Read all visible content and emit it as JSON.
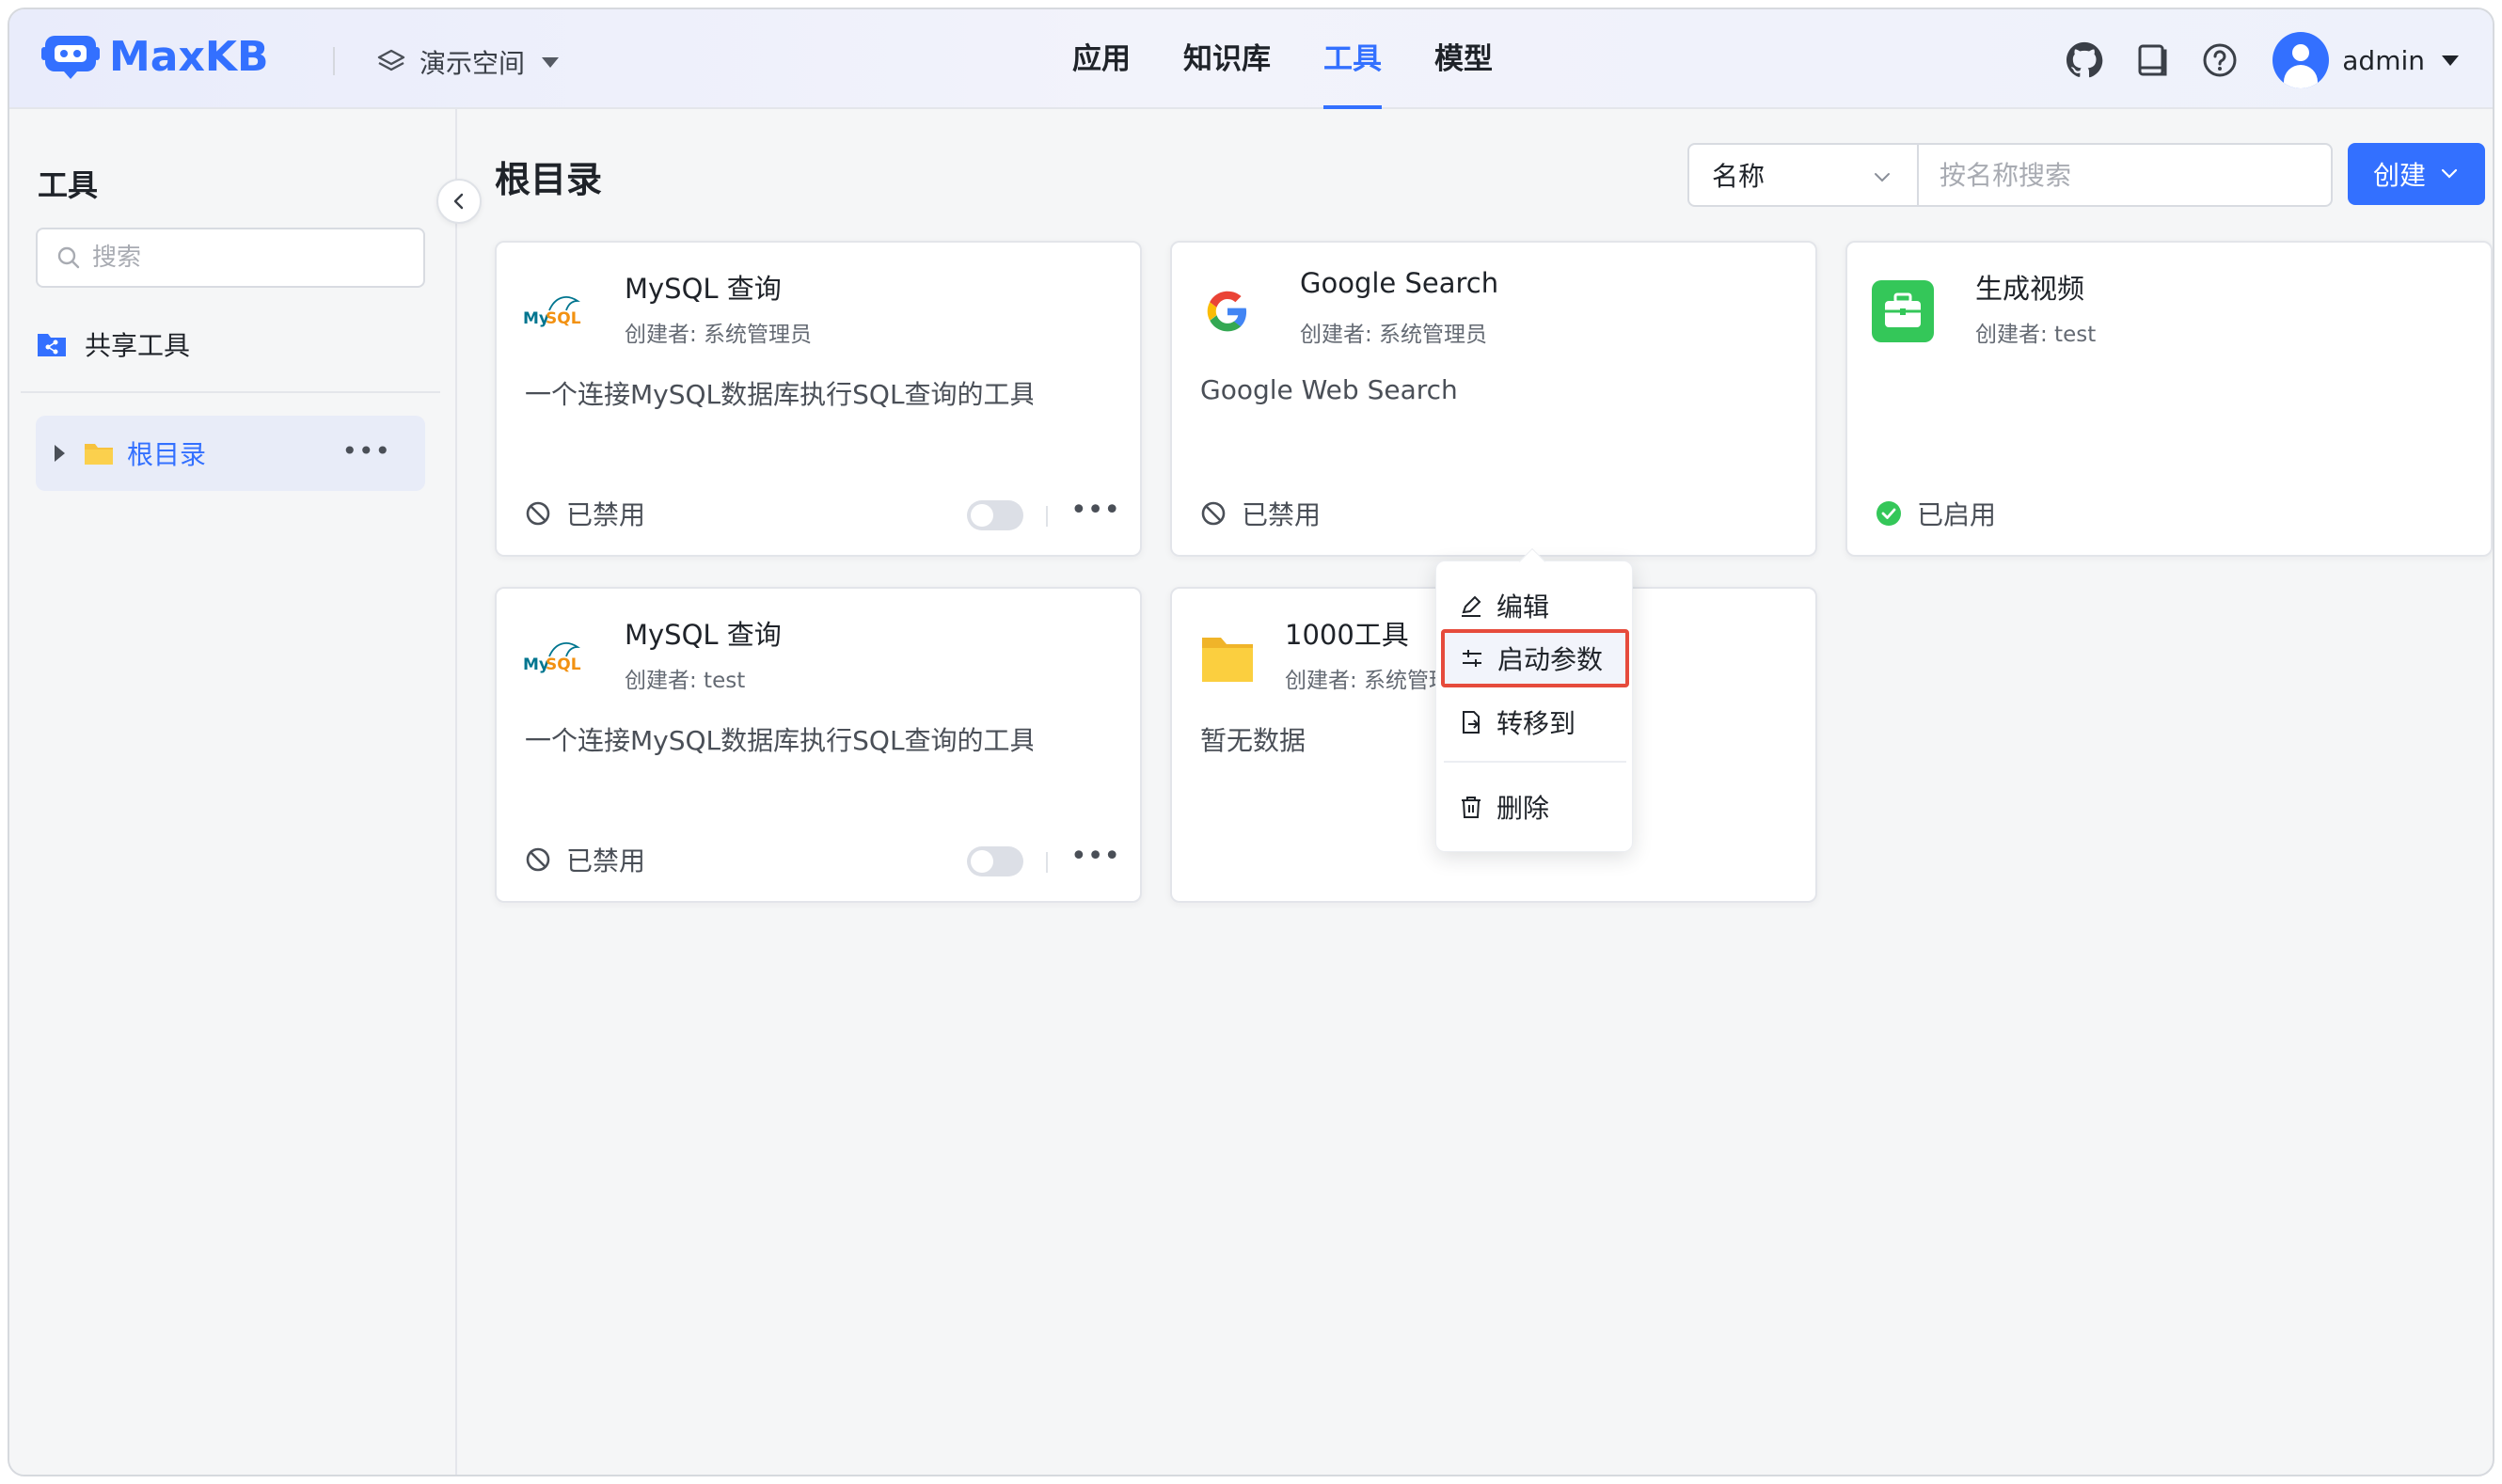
{
  "app": {
    "name": "MaxKB",
    "brand_color": "#3370ff"
  },
  "header": {
    "workspace": "演示空间",
    "nav": [
      "应用",
      "知识库",
      "工具",
      "模型"
    ],
    "active_nav": "工具",
    "icons": [
      "github-icon",
      "docs-icon",
      "help-icon"
    ],
    "user": "admin"
  },
  "sidebar": {
    "title": "工具",
    "search_placeholder": "搜索",
    "shared": "共享工具",
    "root": "根目录"
  },
  "main": {
    "title": "根目录",
    "filter_select": "名称",
    "search_placeholder": "按名称搜索",
    "create_label": "创建",
    "cards": [
      {
        "title": "MySQL 查询",
        "creator": "创建者: 系统管理员",
        "desc": "一个连接MySQL数据库执行SQL查询的工具",
        "status": "已禁用",
        "icon": "mysql-logo"
      },
      {
        "title": "Google Search",
        "creator": "创建者: 系统管理员",
        "desc": "Google Web Search",
        "status": "已禁用",
        "icon": "google-icon"
      },
      {
        "title": "生成视频",
        "creator": "创建者: test",
        "desc": "",
        "status": "已启用",
        "icon": "toolbox-icon"
      },
      {
        "title": "MySQL 查询",
        "creator": "创建者: test",
        "desc": "一个连接MySQL数据库执行SQL查询的工具",
        "status": "已禁用",
        "icon": "mysql-logo"
      },
      {
        "title": "1000工具",
        "creator": "创建者: 系统管理员",
        "desc": "暂无数据",
        "status": "",
        "icon": "folder-icon"
      }
    ],
    "dropdown": [
      "编辑",
      "启动参数",
      "转移到",
      "删除"
    ],
    "dropdown_highlighted": "启动参数"
  }
}
